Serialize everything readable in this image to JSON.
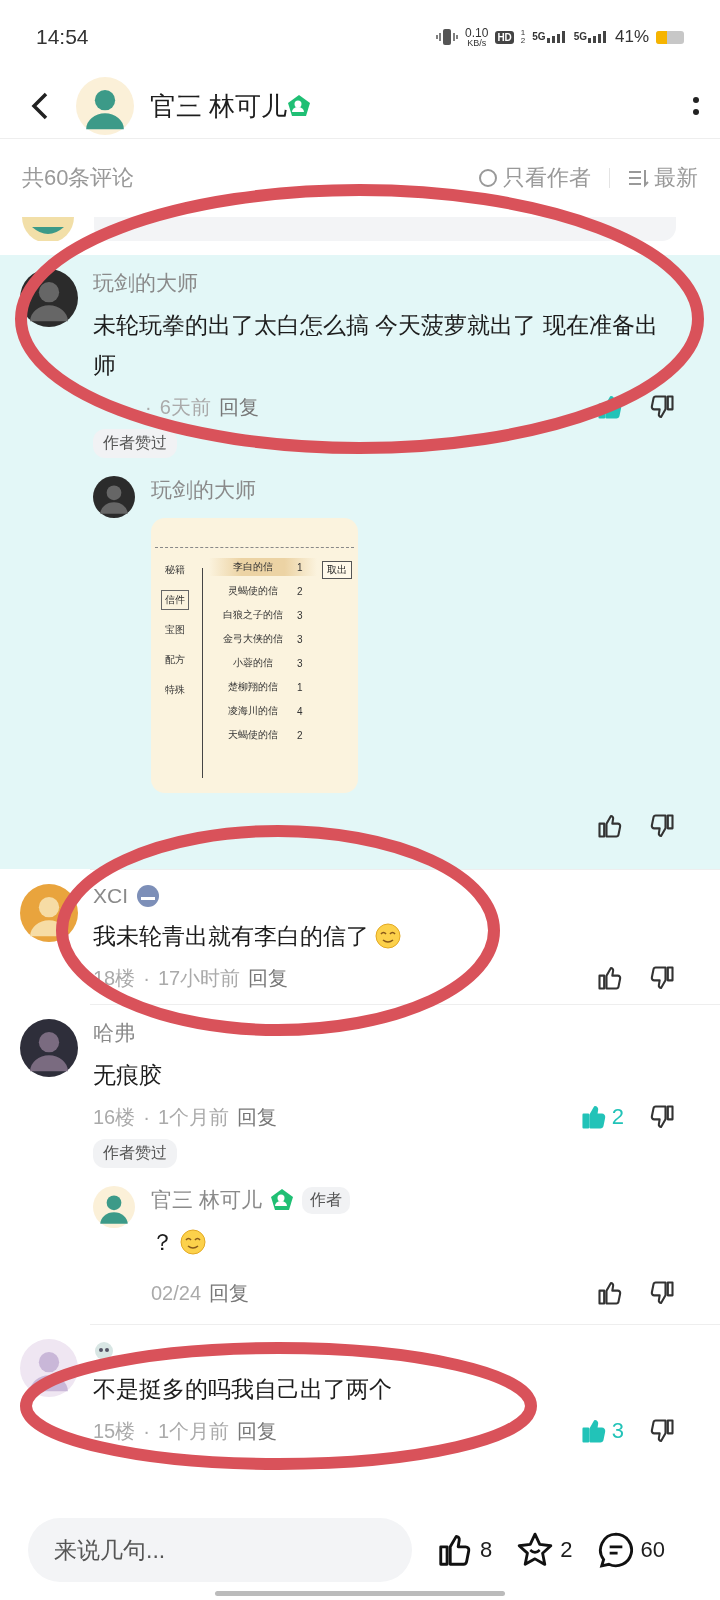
{
  "status_bar": {
    "time": "14:54",
    "speed": "0.10",
    "speed_unit": "KB/s",
    "hd": "HD",
    "sims": [
      "1",
      "2"
    ],
    "networks": [
      "5G",
      "5G"
    ],
    "battery": "41%"
  },
  "header": {
    "title": "官三 林可儿",
    "verified": true
  },
  "comments_bar": {
    "count": "共60条评论",
    "filter": "只看作者",
    "sort": "最新"
  },
  "comments": [
    {
      "name": "玩剑的大师",
      "body": "未轮玩拳的出了太白怎么搞 今天菠萝就出了 现在准备出师",
      "dot": "·",
      "time": "6天前",
      "reply": "回复",
      "liked": true,
      "badge": "作者赞过",
      "highlighted": true,
      "circled": true,
      "replies": [
        {
          "name": "玩剑的大师",
          "liked": false,
          "attachment": {
            "kind": "game-screenshot",
            "tabs": [
              {
                "label": "秘籍",
                "selected": false
              },
              {
                "label": "信件",
                "selected": true
              },
              {
                "label": "宝图",
                "selected": false
              },
              {
                "label": "配方",
                "selected": false
              },
              {
                "label": "特殊",
                "selected": false
              }
            ],
            "items": [
              {
                "name": "李白的信",
                "count": "1",
                "selected": true
              },
              {
                "name": "灵蝎使的信",
                "count": "2",
                "selected": false
              },
              {
                "name": "白狼之子的信",
                "count": "3",
                "selected": false
              },
              {
                "name": "金弓大侠的信",
                "count": "3",
                "selected": false
              },
              {
                "name": "小蓉的信",
                "count": "3",
                "selected": false
              },
              {
                "name": "楚柳翔的信",
                "count": "1",
                "selected": false
              },
              {
                "name": "凌海川的信",
                "count": "4",
                "selected": false
              },
              {
                "name": "天蝎使的信",
                "count": "2",
                "selected": false
              }
            ],
            "button": "取出"
          }
        }
      ]
    },
    {
      "name": "XCI",
      "top_badge": true,
      "body": "我未轮青出就有李白的信了",
      "emoji": true,
      "floor": "18楼",
      "dot": "·",
      "time": "17小时前",
      "reply": "回复",
      "liked": false,
      "highlighted": false,
      "circled": true
    },
    {
      "name": "哈弗",
      "body": "无痕胶",
      "floor": "16楼",
      "dot": "·",
      "time": "1个月前",
      "reply": "回复",
      "liked": true,
      "likes": "2",
      "badge": "作者赞过",
      "highlighted": false,
      "circled": false,
      "replies": [
        {
          "name": "官三 林可儿",
          "verified": true,
          "tag": "作者",
          "body": "？",
          "emoji": true,
          "date": "02/24",
          "reply": "回复",
          "liked": false
        }
      ]
    },
    {
      "pet_badge": true,
      "body": "不是挺多的吗我自己出了两个",
      "floor": "15楼",
      "dot": "·",
      "time": "1个月前",
      "reply": "回复",
      "liked": true,
      "likes": "3",
      "highlighted": false,
      "circled": true
    }
  ],
  "bottom_bar": {
    "placeholder": "来说几句...",
    "likes": "8",
    "stars": "2",
    "comments": "60"
  }
}
